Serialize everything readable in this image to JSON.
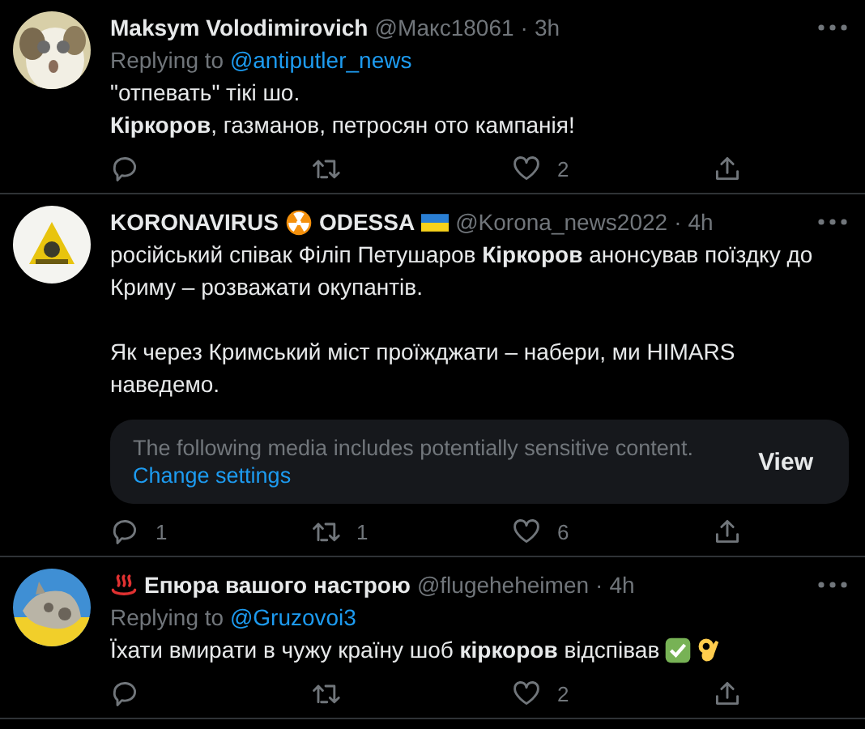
{
  "tweets": [
    {
      "avatar": {
        "kind": "picture"
      },
      "name_parts": [
        {
          "kind": "text",
          "text": "Maksym Volodimirovich"
        }
      ],
      "handle": "@Макс18061",
      "separator": "·",
      "time": "3h",
      "replying_label": "Replying to",
      "replying_to": "@antiputler_news",
      "paragraphs": [
        "\"отпевать\" тікі шо.\n**Кіркоров**, газманов, петросян ото кампанія!"
      ],
      "actions": [
        {
          "kind": "reply"
        },
        {
          "kind": "retweet"
        },
        {
          "kind": "like",
          "count": "2"
        },
        {
          "kind": "share"
        }
      ]
    },
    {
      "avatar": {
        "kind": "picture"
      },
      "name_parts": [
        {
          "kind": "text",
          "text": "KORONAVIRUS"
        },
        {
          "kind": "radiation"
        },
        {
          "kind": "text",
          "text": "ODESSA"
        },
        {
          "kind": "flag"
        }
      ],
      "handle": "@Korona_news2022",
      "separator": "·",
      "time": "4h",
      "paragraphs": [
        "російський співак Філіп Петушаров **Кіркоров** анонсував поїздку до Криму – розважати окупантів.",
        "Як через Кримський міст проїжджати – набери, ми HIMARS наведемо."
      ],
      "notice": {
        "text": "The following media includes potentially sensitive content.",
        "link": "Change settings",
        "button": "View"
      },
      "actions": [
        {
          "kind": "reply",
          "count": "1"
        },
        {
          "kind": "retweet",
          "count": "1"
        },
        {
          "kind": "like",
          "count": "6"
        },
        {
          "kind": "share"
        }
      ]
    },
    {
      "avatar": {
        "kind": "picture"
      },
      "name_parts": [
        {
          "kind": "hot-springs"
        },
        {
          "kind": "text",
          "text": "Епюра вашого настрою"
        }
      ],
      "handle": "@flugeheheimen",
      "separator": "·",
      "time": "4h",
      "replying_label": "Replying to",
      "replying_to": "@Gruzovoi3",
      "paragraphs": [
        "Їхати вмирати в чужу країну шоб **кіркоров** відспівав"
      ],
      "trailing_icons": [
        {
          "kind": "check"
        },
        {
          "kind": "ok-hand"
        }
      ],
      "actions": [
        {
          "kind": "reply"
        },
        {
          "kind": "retweet"
        },
        {
          "kind": "like",
          "count": "2"
        },
        {
          "kind": "share"
        }
      ]
    }
  ]
}
